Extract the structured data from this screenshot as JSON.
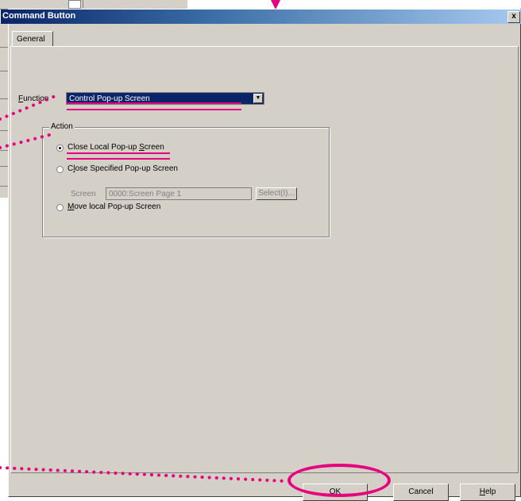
{
  "dialog": {
    "title": "Command Button",
    "close_glyph": "x",
    "tab_label": "General",
    "function": {
      "label_prefix": "F",
      "label_rest": "unction",
      "selected_value": "Control Pop-up Screen"
    },
    "action_group": {
      "legend": "Action",
      "options": [
        {
          "label_before": "Close Local Pop-up ",
          "label_underline": "S",
          "label_after": "creen",
          "selected": true
        },
        {
          "label_before": "C",
          "label_underline": "l",
          "label_after": "ose Specified Pop-up Screen",
          "selected": false
        },
        {
          "label_before": "",
          "label_underline": "M",
          "label_after": "ove local Pop-up Screen",
          "selected": false
        }
      ],
      "screen_label": "Screen",
      "screen_value": "0000:Screen Page 1",
      "select_button": "Select(I)..."
    },
    "buttons": {
      "ok": "OK",
      "cancel": "Cancel",
      "help_underline": "H",
      "help_rest": "elp"
    }
  },
  "annotation_color": "#e6007e"
}
